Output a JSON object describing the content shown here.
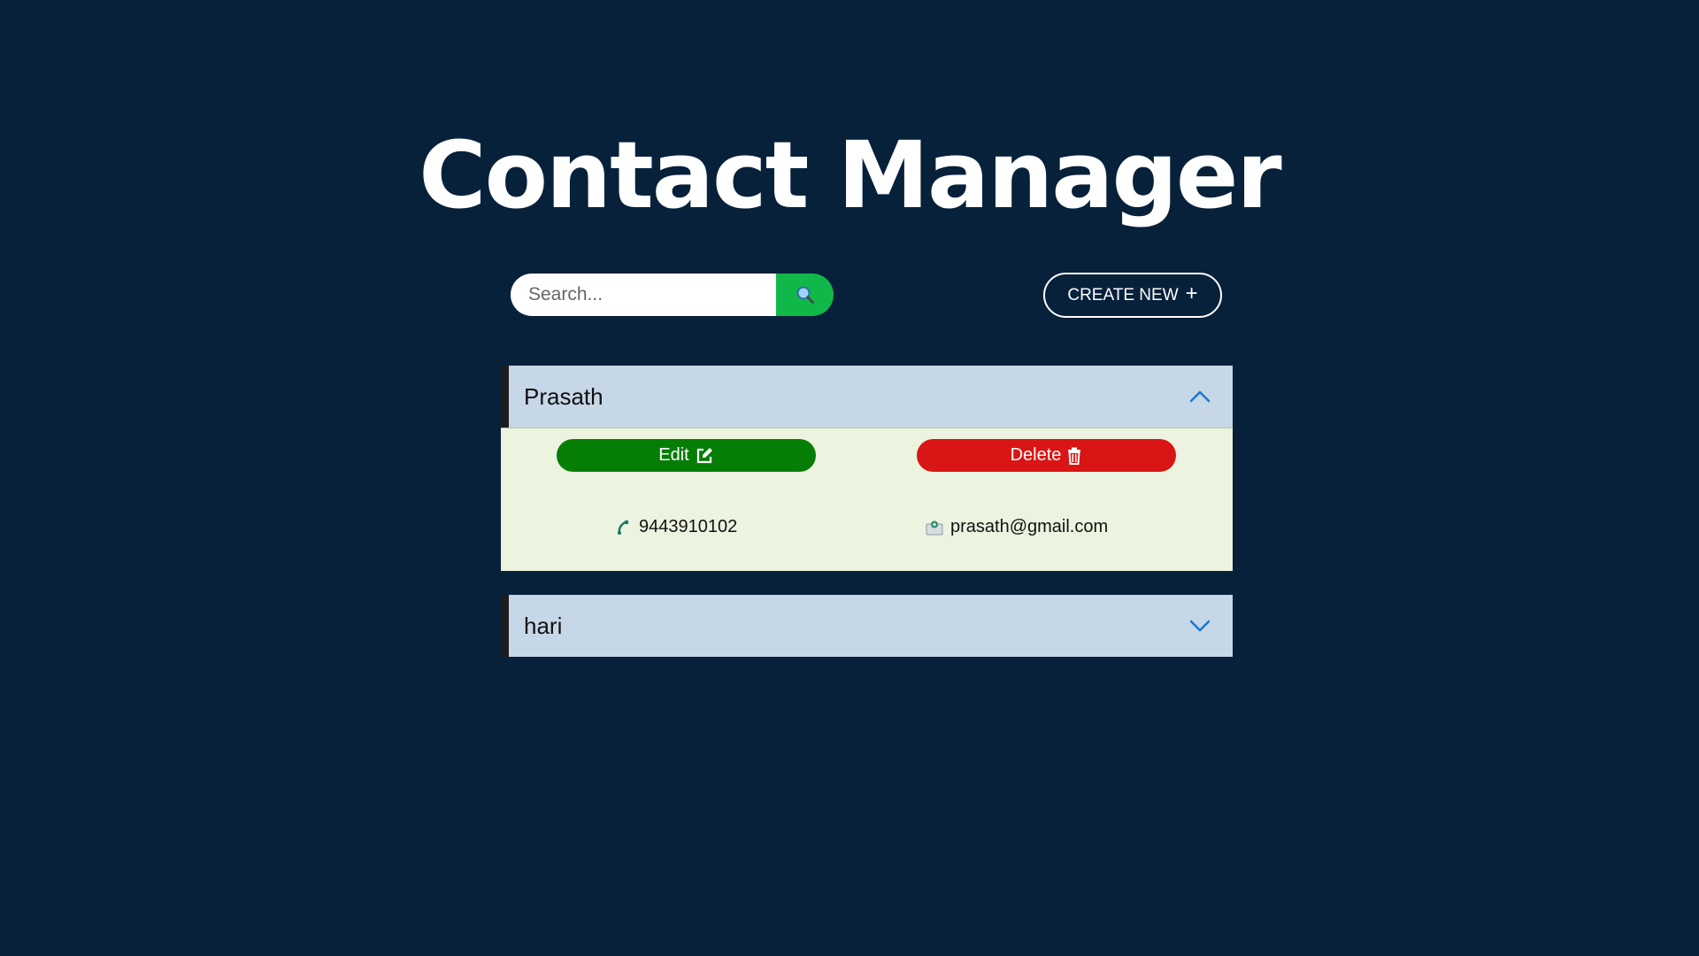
{
  "header": {
    "title": "Contact Manager"
  },
  "search": {
    "placeholder": "Search..."
  },
  "toolbar": {
    "create_label": "CREATE NEW",
    "create_icon": "plus-icon"
  },
  "contacts": [
    {
      "name": "Prasath",
      "expanded": true,
      "edit_label": "Edit",
      "delete_label": "Delete",
      "phone": "9443910102",
      "email": "prasath@gmail.com"
    },
    {
      "name": "hari",
      "expanded": false
    }
  ],
  "colors": {
    "background": "#07213b",
    "search_button": "#10b84a",
    "header_bg": "#c6d7e7",
    "body_bg": "#ecf3df",
    "edit": "#067e06",
    "delete": "#d91515",
    "chevron": "#1a78d4"
  }
}
